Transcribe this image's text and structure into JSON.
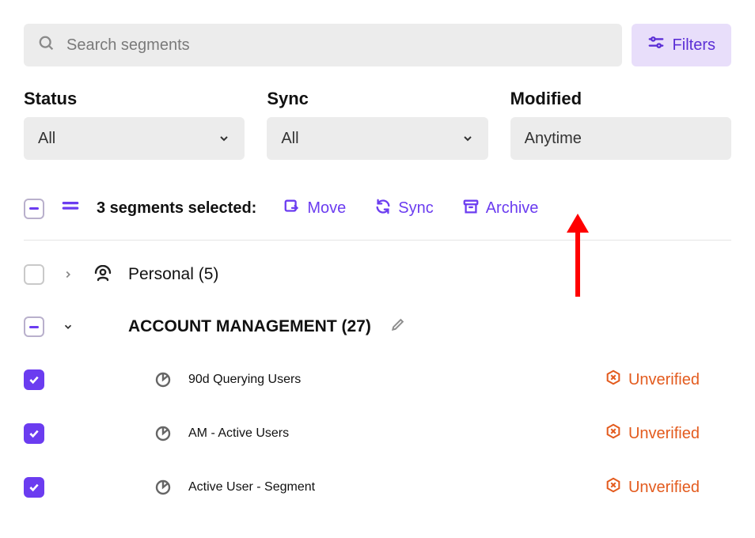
{
  "search": {
    "placeholder": "Search segments"
  },
  "filters_button": "Filters",
  "filters": {
    "status": {
      "label": "Status",
      "value": "All"
    },
    "sync": {
      "label": "Sync",
      "value": "All"
    },
    "modified": {
      "label": "Modified",
      "value": "Anytime"
    }
  },
  "bulk": {
    "count_text": "3 segments selected:",
    "actions": {
      "move": "Move",
      "sync": "Sync",
      "archive": "Archive"
    }
  },
  "groups": {
    "personal": {
      "label": "Personal (5)"
    },
    "account": {
      "label": "ACCOUNT MANAGEMENT (27)"
    }
  },
  "segments": [
    {
      "name": "90d Querying Users",
      "status": "Unverified"
    },
    {
      "name": "AM - Active Users",
      "status": "Unverified"
    },
    {
      "name": "Active User - Segment",
      "status": "Unverified"
    }
  ]
}
